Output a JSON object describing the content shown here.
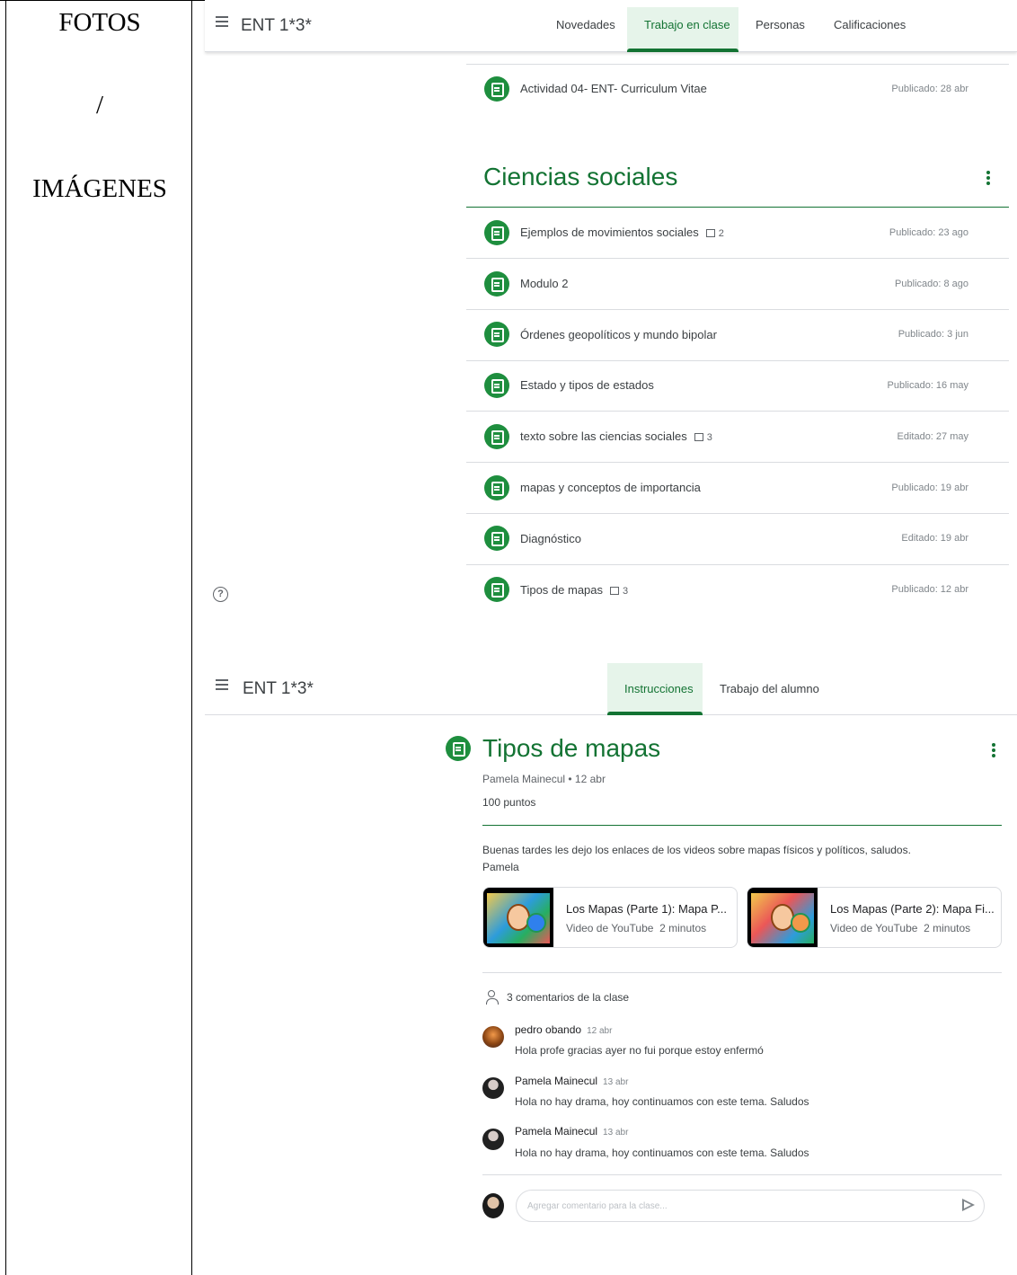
{
  "left_column": {
    "line1": "FOTOS",
    "line2": "/",
    "line3": "IMÁGENES"
  },
  "stream": {
    "class_title": "ENT 1*3*",
    "tabs": [
      "Novedades",
      "Trabajo en clase",
      "Personas",
      "Calificaciones"
    ],
    "active_tab": "Trabajo en clase",
    "prev_item": {
      "title": "Actividad 04- ENT- Curriculum Vitae",
      "date": "Publicado: 28 abr"
    },
    "topic": "Ciencias sociales",
    "items": [
      {
        "title": "Ejemplos de movimientos sociales",
        "comments": "2",
        "date": "Publicado: 23 ago"
      },
      {
        "title": "Modulo 2",
        "comments": "",
        "date": "Publicado: 8 ago"
      },
      {
        "title": "Órdenes geopolíticos y mundo bipolar",
        "comments": "",
        "date": "Publicado: 3 jun"
      },
      {
        "title": "Estado y tipos de estados",
        "comments": "",
        "date": "Publicado: 16 may"
      },
      {
        "title": "texto sobre las ciencias sociales",
        "comments": "3",
        "date": "Editado: 27 may"
      },
      {
        "title": "mapas y conceptos de importancia",
        "comments": "",
        "date": "Publicado: 19 abr"
      },
      {
        "title": "Diagnóstico",
        "comments": "",
        "date": "Editado: 19 abr"
      },
      {
        "title": "Tipos de mapas",
        "comments": "3",
        "date": "Publicado: 12 abr"
      }
    ],
    "help_icon": "help-icon"
  },
  "detail": {
    "class_title": "ENT 1*3*",
    "tabs": [
      "Instrucciones",
      "Trabajo del alumno"
    ],
    "active_tab": "Instrucciones",
    "title": "Tipos de mapas",
    "meta": "Pamela Mainecul • 12 abr",
    "points": "100 puntos",
    "body_line1": "Buenas tardes les dejo los enlaces de los videos sobre mapas físicos y políticos, saludos.",
    "body_line2": "Pamela",
    "videos": [
      {
        "title": "Los Mapas (Parte 1): Mapa P...",
        "source": "Video de YouTube",
        "duration": "2 minutos"
      },
      {
        "title": "Los Mapas (Parte 2): Mapa Fi...",
        "source": "Video de YouTube",
        "duration": "2 minutos"
      }
    ],
    "comments_header": "3 comentarios de la clase",
    "comments": [
      {
        "author": "pedro obando",
        "date": "12 abr",
        "text": "Hola profe gracias ayer no fui porque estoy enfermó"
      },
      {
        "author": "Pamela Mainecul",
        "date": "13 abr",
        "text": "Hola no hay drama, hoy continuamos con este tema. Saludos"
      },
      {
        "author": "Pamela Mainecul",
        "date": "13 abr",
        "text": "Hola no hay drama, hoy continuamos con este tema. Saludos"
      }
    ],
    "comment_placeholder": "Agregar comentario para la clase..."
  },
  "colors": {
    "accent": "#137333",
    "icon_green": "#1e8e3e",
    "active_tab_bg": "#e6f4ea"
  }
}
